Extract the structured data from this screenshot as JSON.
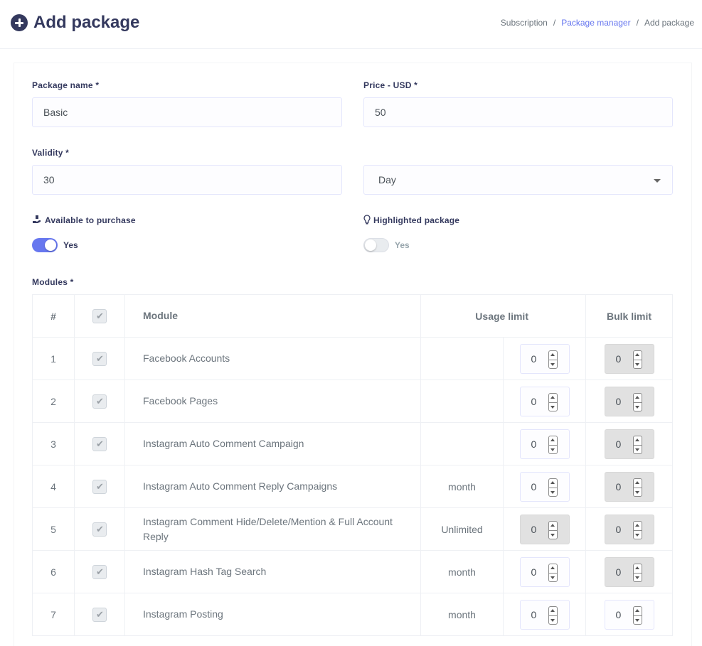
{
  "header": {
    "title": "Add package",
    "breadcrumb": [
      "Subscription",
      "Package manager",
      "Add package"
    ],
    "separator": "/"
  },
  "form": {
    "package_name": {
      "label": "Package name *",
      "value": "Basic"
    },
    "price": {
      "label": "Price - USD *",
      "value": "50"
    },
    "validity": {
      "label": "Validity *",
      "value": "30"
    },
    "validity_unit": {
      "selected": "Day"
    },
    "available": {
      "label": "Available to purchase",
      "toggle_text": "Yes",
      "on": true
    },
    "highlighted": {
      "label": "Highlighted package",
      "toggle_text": "Yes",
      "on": false
    },
    "modules_label": "Modules *"
  },
  "modules_table": {
    "headers": {
      "num": "#",
      "module": "Module",
      "usage": "Usage limit",
      "bulk": "Bulk limit"
    },
    "rows": [
      {
        "num": "1",
        "module": "Facebook Accounts",
        "period": "",
        "usage": "0",
        "usage_disabled": false,
        "bulk": "0",
        "bulk_disabled": true
      },
      {
        "num": "2",
        "module": "Facebook Pages",
        "period": "",
        "usage": "0",
        "usage_disabled": false,
        "bulk": "0",
        "bulk_disabled": true
      },
      {
        "num": "3",
        "module": "Instagram Auto Comment Campaign",
        "period": "",
        "usage": "0",
        "usage_disabled": false,
        "bulk": "0",
        "bulk_disabled": true
      },
      {
        "num": "4",
        "module": "Instagram Auto Comment Reply Campaigns",
        "period": "month",
        "usage": "0",
        "usage_disabled": false,
        "bulk": "0",
        "bulk_disabled": true
      },
      {
        "num": "5",
        "module": "Instagram Comment Hide/Delete/Mention & Full Account Reply",
        "period": "Unlimited",
        "usage": "0",
        "usage_disabled": true,
        "bulk": "0",
        "bulk_disabled": true
      },
      {
        "num": "6",
        "module": "Instagram Hash Tag Search",
        "period": "month",
        "usage": "0",
        "usage_disabled": false,
        "bulk": "0",
        "bulk_disabled": true
      },
      {
        "num": "7",
        "module": "Instagram Posting",
        "period": "month",
        "usage": "0",
        "usage_disabled": false,
        "bulk": "0",
        "bulk_disabled": false
      }
    ]
  },
  "colors": {
    "primary": "#6777ef",
    "text": "#34395e",
    "muted": "#6c757d"
  }
}
